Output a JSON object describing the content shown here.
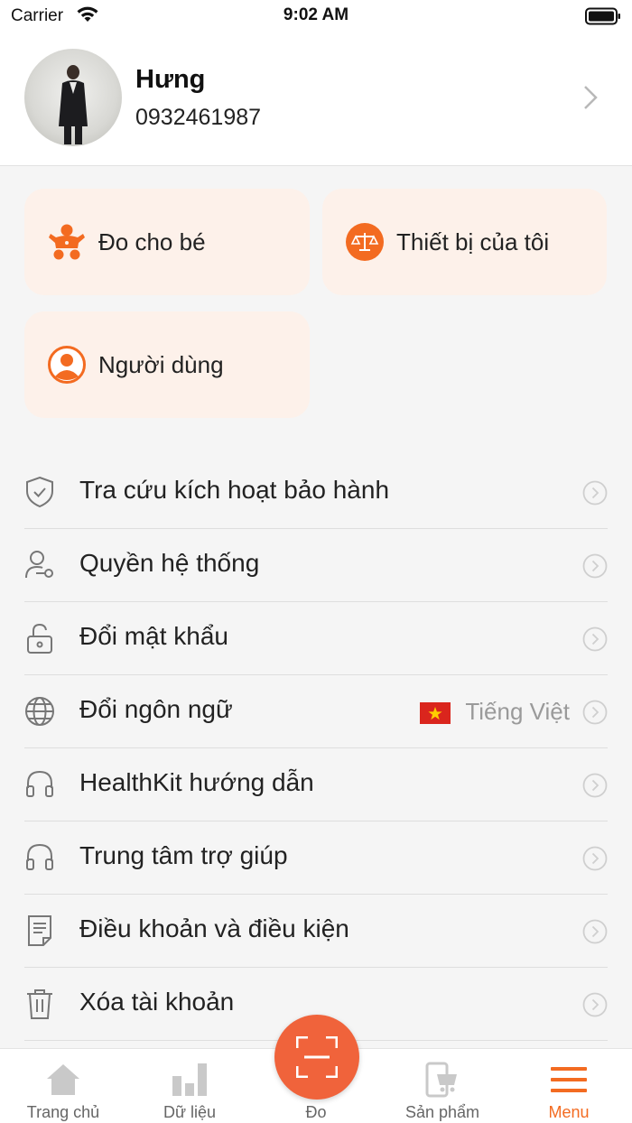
{
  "status_bar": {
    "carrier": "Carrier",
    "time": "9:02 AM"
  },
  "profile": {
    "name": "Hưng",
    "phone": "0932461987"
  },
  "quick_cards": [
    {
      "label": "Đo cho bé",
      "icon": "baby-icon"
    },
    {
      "label": "Thiết bị của tôi",
      "icon": "scale-icon"
    },
    {
      "label": "Người dùng",
      "icon": "user-icon"
    }
  ],
  "menu": [
    {
      "label": "Tra cứu kích hoạt bảo hành",
      "icon": "shield-check-icon"
    },
    {
      "label": "Quyền hệ thống",
      "icon": "user-key-icon"
    },
    {
      "label": "Đổi mật khẩu",
      "icon": "lock-icon"
    },
    {
      "label": "Đổi ngôn ngữ",
      "icon": "globe-icon",
      "value": "Tiếng Việt"
    },
    {
      "label": "HealthKit hướng dẫn",
      "icon": "headset-icon"
    },
    {
      "label": "Trung tâm trợ giúp",
      "icon": "headset-icon"
    },
    {
      "label": "Điều khoản và điều kiện",
      "icon": "document-icon"
    },
    {
      "label": "Xóa tài khoản",
      "icon": "trash-icon"
    }
  ],
  "tabs": [
    {
      "label": "Trang chủ",
      "icon": "home-icon"
    },
    {
      "label": "Dữ liệu",
      "icon": "bar-chart-icon"
    },
    {
      "label": "Đo",
      "icon": "scan-icon"
    },
    {
      "label": "Sản phẩm",
      "icon": "product-cart-icon"
    },
    {
      "label": "Menu",
      "icon": "menu-icon",
      "active": true
    }
  ],
  "colors": {
    "accent": "#f36b21",
    "card_bg": "#fdf1ea",
    "scan_button": "#f0633b"
  }
}
